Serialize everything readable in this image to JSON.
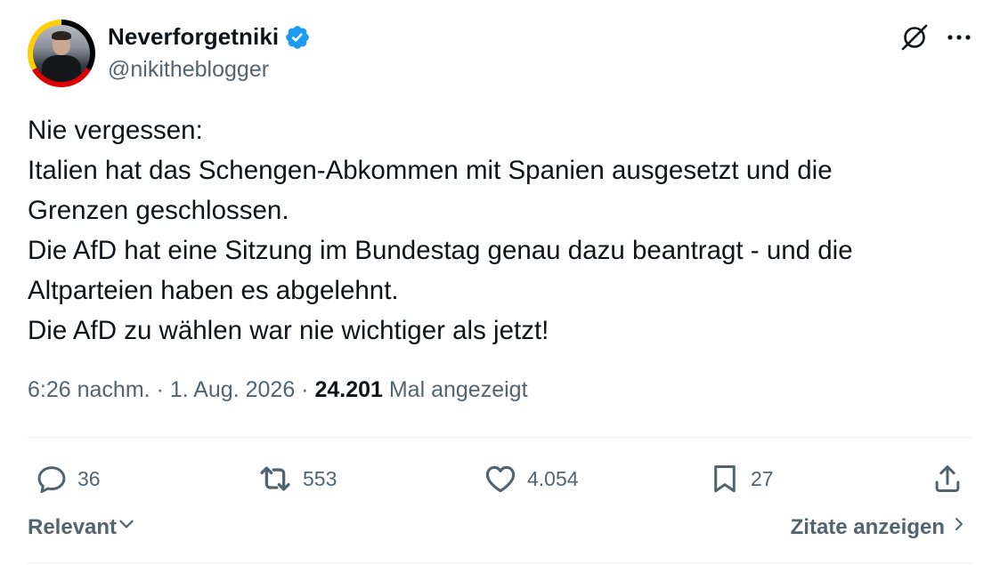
{
  "author": {
    "display_name": "Neverforgetniki",
    "handle": "@nikitheblogger",
    "verified": true,
    "verified_color": "#1d9bf0",
    "avatar_icon": "profile-photo",
    "avatar_ring_colors": [
      "#000000",
      "#dd0000",
      "#ffce00"
    ]
  },
  "header_icons": {
    "grok": "grok-icon",
    "more": "more-icon"
  },
  "tweet": {
    "lines": [
      "Nie vergessen:",
      "Italien hat das Schengen-Abkommen mit Spanien ausgesetzt und die",
      "Grenzen geschlossen.",
      "Die AfD hat eine Sitzung im Bundestag genau dazu beantragt - und die",
      "Altparteien haben es abgelehnt.",
      "Die AfD zu wählen war nie wichtiger als jetzt!"
    ]
  },
  "meta": {
    "time": "6:26 nachm.",
    "separator": " · ",
    "date": "1. Aug. 2026",
    "views": "24.201",
    "views_label": "Mal angezeigt"
  },
  "actions": {
    "replies": {
      "icon": "reply-icon",
      "count": "36"
    },
    "retweets": {
      "icon": "retweet-icon",
      "count": "553"
    },
    "likes": {
      "icon": "heart-icon",
      "count": "4.054"
    },
    "bookmarks": {
      "icon": "bookmark-icon",
      "count": "27"
    },
    "share": {
      "icon": "share-icon"
    }
  },
  "footer": {
    "sort_label": "Relevant",
    "quotes_label": "Zitate anzeigen"
  },
  "colors": {
    "text": "#0f1419",
    "secondary": "#536471",
    "divider": "#eff3f4"
  }
}
